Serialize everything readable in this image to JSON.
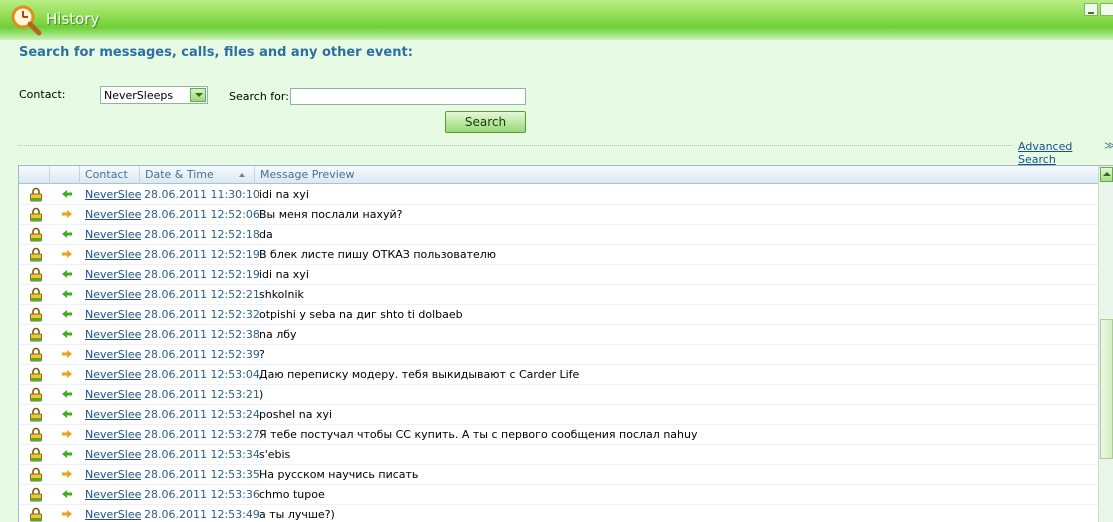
{
  "window": {
    "title": "History"
  },
  "search": {
    "heading": "Search for messages, calls, files and any other event:",
    "contact_label": "Contact:",
    "contact_value": "NeverSleeps",
    "search_for_label": "Search for:",
    "search_for_value": "",
    "search_button": "Search",
    "advanced_link": "Advanced Search"
  },
  "table": {
    "columns": [
      "Contact",
      "Date & Time",
      "Message Preview"
    ],
    "rows": [
      {
        "contact": "NeverSleeps",
        "datetime": "28.06.2011 11:30:10",
        "message": "idi na xyi",
        "direction": "incoming"
      },
      {
        "contact": "NeverSleeps",
        "datetime": "28.06.2011 12:52:06",
        "message": "Вы меня послали нахуй?",
        "direction": "outgoing"
      },
      {
        "contact": "NeverSleeps",
        "datetime": "28.06.2011 12:52:18",
        "message": "da",
        "direction": "incoming"
      },
      {
        "contact": "NeverSleeps",
        "datetime": "28.06.2011 12:52:19",
        "message": "В блек листе пишу ОТКАЗ пользователю",
        "direction": "outgoing"
      },
      {
        "contact": "NeverSleeps",
        "datetime": "28.06.2011 12:52:19",
        "message": "idi na xyi",
        "direction": "incoming"
      },
      {
        "contact": "NeverSleeps",
        "datetime": "28.06.2011 12:52:21",
        "message": "shkolnik",
        "direction": "incoming"
      },
      {
        "contact": "NeverSleeps",
        "datetime": "28.06.2011 12:52:32",
        "message": "otpishi y seba na диг shto ti dolbaeb",
        "direction": "incoming"
      },
      {
        "contact": "NeverSleeps",
        "datetime": "28.06.2011 12:52:38",
        "message": "na лбу",
        "direction": "incoming"
      },
      {
        "contact": "NeverSleeps",
        "datetime": "28.06.2011 12:52:39",
        "message": "?",
        "direction": "outgoing"
      },
      {
        "contact": "NeverSleeps",
        "datetime": "28.06.2011 12:53:04",
        "message": "Даю переписку модеру. тебя выкидывают с Carder Life",
        "direction": "outgoing"
      },
      {
        "contact": "NeverSleeps",
        "datetime": "28.06.2011 12:53:21",
        "message": ")",
        "direction": "incoming"
      },
      {
        "contact": "NeverSleeps",
        "datetime": "28.06.2011 12:53:24",
        "message": "poshel na xyi",
        "direction": "incoming"
      },
      {
        "contact": "NeverSleeps",
        "datetime": "28.06.2011 12:53:27",
        "message": "Я тебе постучал чтобы СС купить. А ты с первого сообщения послал nahuy",
        "direction": "outgoing"
      },
      {
        "contact": "NeverSleeps",
        "datetime": "28.06.2011 12:53:34",
        "message": "s'ebis",
        "direction": "incoming"
      },
      {
        "contact": "NeverSleeps",
        "datetime": "28.06.2011 12:53:35",
        "message": "На русском научись писать",
        "direction": "outgoing"
      },
      {
        "contact": "NeverSleeps",
        "datetime": "28.06.2011 12:53:36",
        "message": "chmo tupoe",
        "direction": "incoming"
      },
      {
        "contact": "NeverSleeps",
        "datetime": "28.06.2011 12:53:49",
        "message": "а ты лучше?)",
        "direction": "outgoing"
      }
    ]
  },
  "colors": {
    "incoming_arrow": "#3fae22",
    "outgoing_arrow": "#f0a020",
    "link": "#1a4f8f",
    "heading": "#2c6fa0"
  },
  "icons": {
    "row_lock": "padlock-icon",
    "incoming": "arrow-left-icon",
    "outgoing": "arrow-right-icon",
    "app": "magnifier-clock-icon"
  }
}
